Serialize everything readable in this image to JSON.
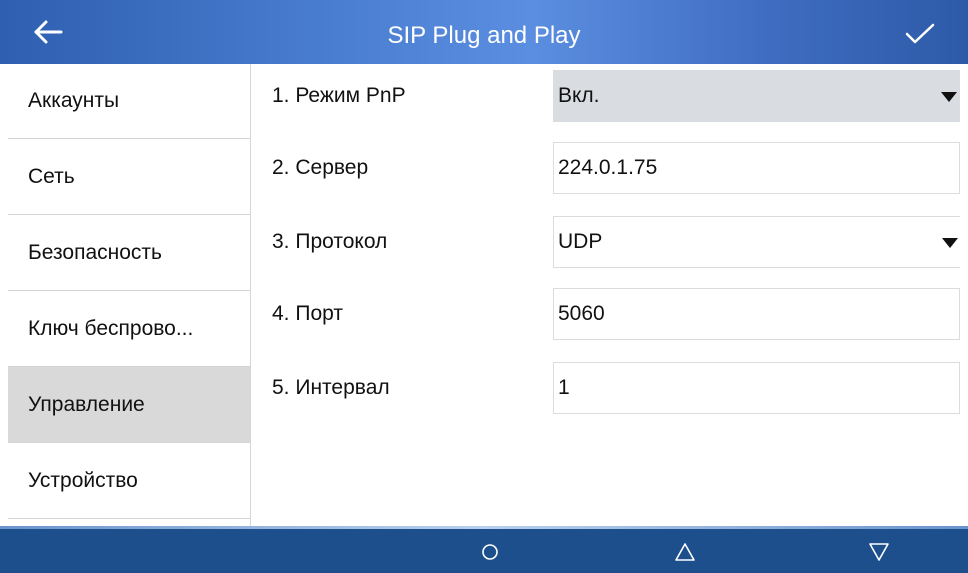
{
  "header": {
    "title": "SIP Plug and Play",
    "back_icon": "arrow-left-icon",
    "confirm_icon": "checkmark-icon"
  },
  "sidebar": {
    "items": [
      {
        "label": "Аккаунты",
        "active": false
      },
      {
        "label": "Сеть",
        "active": false
      },
      {
        "label": "Безопасность",
        "active": false
      },
      {
        "label": "Ключ беспрово...",
        "active": false
      },
      {
        "label": "Управление",
        "active": true
      },
      {
        "label": "Устройство",
        "active": false
      }
    ]
  },
  "form": {
    "rows": [
      {
        "label": "1. Режим PnP",
        "value": "Вкл.",
        "type": "select"
      },
      {
        "label": "2. Сервер",
        "value": "224.0.1.75",
        "type": "input"
      },
      {
        "label": "3. Протокол",
        "value": "UDP",
        "type": "select"
      },
      {
        "label": "4. Порт",
        "value": "5060",
        "type": "input"
      },
      {
        "label": "5. Интервал",
        "value": "1",
        "type": "input"
      }
    ]
  },
  "navbar": {
    "home_icon": "circle-home-icon",
    "up_icon": "triangle-up-icon",
    "down_icon": "triangle-down-icon"
  },
  "colors": {
    "header_bg": "#3f6cc0",
    "navbar_bg": "#1d4f8c",
    "active_item_bg": "#d9d9d9",
    "selected_field_bg": "#d9dce0"
  }
}
